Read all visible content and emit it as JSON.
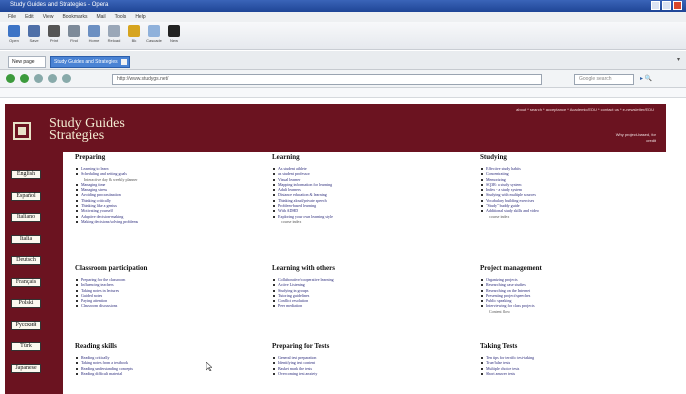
{
  "window": {
    "title": "Study Guides and Strategies - Opera"
  },
  "menubar": [
    "File",
    "Edit",
    "View",
    "Bookmarks",
    "Mail",
    "Tools",
    "Help"
  ],
  "toolbar": [
    {
      "label": "Open",
      "color": "#3d74c6"
    },
    {
      "label": "Save",
      "color": "#4e6fa8"
    },
    {
      "label": "Print",
      "color": "#555555"
    },
    {
      "label": "Find",
      "color": "#7d8a99"
    },
    {
      "label": "Home",
      "color": "#6b8fc2"
    },
    {
      "label": "Reload",
      "color": "#9aa7b8"
    },
    {
      "label": "Bk",
      "color": "#d6a41f"
    },
    {
      "label": "Cascade",
      "color": "#8fb1db"
    },
    {
      "label": "New",
      "color": "#222222"
    }
  ],
  "tabs": {
    "first": "New page",
    "active": "Study Guides and Strategies"
  },
  "address": {
    "url": "http://www.studygs.net/",
    "search_placeholder": "Google search"
  },
  "banner": {
    "toplinks": "about * search * acceptance * Academic/EDU * contact us * e-newsletter/EDU",
    "logo_line1": "Study Guides",
    "logo_line2": "Strategies",
    "right_text": "Why project-based, for credit"
  },
  "sidebar": [
    "English",
    "Español",
    "Italiano",
    "Italia",
    "Deutsch",
    "Français",
    "Polski",
    "Русский",
    "Türk",
    "Japanese"
  ],
  "sections": [
    {
      "title": "Preparing",
      "items": [
        "Learning to learn",
        "Scheduling and setting goals",
        "Managing time",
        "Managing stress",
        "Avoiding procrastination",
        "Thinking critically",
        "Thinking like a genius",
        "Motivating yourself",
        "Adaptive decision-making",
        "Making decisions/solving problems"
      ],
      "sub": {
        "1": "Interactive day & weekly planner"
      }
    },
    {
      "title": "Learning",
      "items": [
        "As student athlete",
        "as student professor",
        "Visual learner",
        "Mapping information for learning",
        "Adult learners",
        "Distance education & learning",
        "Thinking aloud/private speech",
        "Problem-based learning",
        "With ADHD",
        "Exploring your own learning style"
      ],
      "sub": {
        "9": "course index"
      }
    },
    {
      "title": "Studying",
      "items": [
        "Effective study habits",
        "Concentrating",
        "Memorizing",
        "SQ3R: a study system",
        "Index - a study system",
        "Studying with multiple sources",
        "Vocabulary building exercises",
        "\"Study\" buddy guide",
        "Additional study skills and video"
      ],
      "sub": {
        "8": "course index"
      }
    },
    {
      "title": "Classroom participation",
      "items": [
        "Preparing for the classroom",
        "Influencing teachers",
        "Taking notes in lectures",
        "Guided notes",
        "Paying attention",
        "Classroom discussions"
      ],
      "sub": {}
    },
    {
      "title": "Learning with others",
      "items": [
        "Collaborative/cooperative learning",
        "Active Listening",
        "Studying in groups",
        "Tutoring guidelines",
        "Conflict resolution",
        "Peer mediation"
      ],
      "sub": {}
    },
    {
      "title": "Project management",
      "items": [
        "Organizing projects",
        "Researching case studies",
        "Researching on the Internet",
        "Presenting project/speeches",
        "Public speaking",
        "Interviewing for class projects"
      ],
      "sub": {
        "5": "Content flow"
      }
    },
    {
      "title": "Reading skills",
      "items": [
        "Reading critically",
        "Taking notes from a textbook",
        "Reading understanding concepts",
        "Reading difficult material"
      ],
      "sub": {}
    },
    {
      "title": "Preparing for Tests",
      "items": [
        "General test preparation",
        "Identifying test content",
        "Basket mark the tests",
        "Overcoming test anxiety"
      ],
      "sub": {}
    },
    {
      "title": "Taking Tests",
      "items": [
        "Ten tips for terrific test-taking",
        "True/false tests",
        "Multiple choice tests",
        "Short answer tests"
      ],
      "sub": {}
    }
  ]
}
